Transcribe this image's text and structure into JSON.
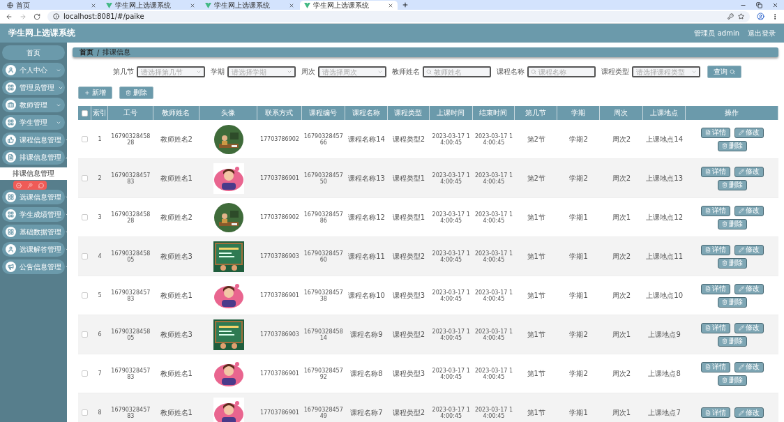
{
  "browser": {
    "tabs": [
      {
        "title": "首页",
        "selected": false,
        "kind": "globe"
      },
      {
        "title": "学生网上选课系统",
        "selected": false,
        "kind": "vue"
      },
      {
        "title": "学生网上选课系统",
        "selected": false,
        "kind": "vue"
      },
      {
        "title": "学生网上选课系统",
        "selected": true,
        "kind": "vue"
      }
    ],
    "address": "localhost:8081/#/paike"
  },
  "header": {
    "title": "学生网上选课系统",
    "user": "管理员 admin",
    "logout": "退出登录"
  },
  "sidebar": {
    "items": [
      {
        "label": "首页",
        "kind": "home"
      },
      {
        "label": "个人中心",
        "kind": "menu",
        "expanded": false
      },
      {
        "label": "管理员管理",
        "kind": "menu",
        "expanded": false
      },
      {
        "label": "教师管理",
        "kind": "menu",
        "expanded": false
      },
      {
        "label": "学生管理",
        "kind": "menu",
        "expanded": false
      },
      {
        "label": "课程信息管理",
        "kind": "menu",
        "expanded": false
      },
      {
        "label": "排课信息管理",
        "kind": "menu",
        "expanded": true,
        "children": [
          {
            "label": "排课信息管理"
          }
        ]
      },
      {
        "label": "选课信息管理",
        "kind": "menu",
        "expanded": false
      },
      {
        "label": "学生成绩管理",
        "kind": "menu",
        "expanded": false
      },
      {
        "label": "基础数据管理",
        "kind": "menu",
        "expanded": false
      },
      {
        "label": "选课解答管理",
        "kind": "menu",
        "expanded": false
      },
      {
        "label": "公告信息管理",
        "kind": "menu",
        "expanded": false
      }
    ]
  },
  "breadcrumb": {
    "items": [
      "首页",
      "排课信息"
    ],
    "separator": "/"
  },
  "filters": [
    {
      "label": "第几节",
      "kind": "select",
      "placeholder": "请选择第几节"
    },
    {
      "label": "学期",
      "kind": "select",
      "placeholder": "请选择学期"
    },
    {
      "label": "周次",
      "kind": "select",
      "placeholder": "请选择周次"
    },
    {
      "label": "教师姓名",
      "kind": "input",
      "placeholder": "教师姓名"
    },
    {
      "label": "课程名称",
      "kind": "input",
      "placeholder": "课程名称"
    },
    {
      "label": "课程类型",
      "kind": "select",
      "placeholder": "请选择课程类型"
    }
  ],
  "search_button": "查询",
  "toolbar": [
    {
      "label": "新增",
      "kind": "add"
    },
    {
      "label": "删除",
      "kind": "delete"
    }
  ],
  "table": {
    "all_checked": false,
    "columns": [
      "索引",
      "工号",
      "教师姓名",
      "头像",
      "联系方式",
      "课程编号",
      "课程名称",
      "课程类型",
      "上课时间",
      "结束时间",
      "第几节",
      "学期",
      "周次",
      "上课地点",
      "操作"
    ],
    "rows": [
      {
        "checked": false,
        "index": "1",
        "id": "1679032845828",
        "teacher": "教师姓名2",
        "phone": "17703786902",
        "course_no": "1679032845766",
        "course_name": "课程名称14",
        "course_type": "课程类型2",
        "start": "2023-03-17 14:00:45",
        "end": "2023-03-17 14:00:45",
        "section": "第2节",
        "term": "学期2",
        "week": "周次2",
        "place": "上课地点14",
        "actions": [
          {
            "label": "详情",
            "kind": "detail"
          },
          {
            "label": "修改",
            "kind": "edit"
          },
          {
            "label": "删除",
            "kind": "delete"
          }
        ]
      },
      {
        "checked": false,
        "index": "2",
        "id": "1679032845783",
        "teacher": "教师姓名1",
        "phone": "17703786901",
        "course_no": "1679032845750",
        "course_name": "课程名称13",
        "course_type": "课程类型1",
        "start": "2023-03-17 14:00:45",
        "end": "2023-03-17 14:00:45",
        "section": "第2节",
        "term": "学期2",
        "week": "周次2",
        "place": "上课地点13",
        "actions": [
          {
            "label": "详情",
            "kind": "detail"
          },
          {
            "label": "修改",
            "kind": "edit"
          },
          {
            "label": "删除",
            "kind": "delete"
          }
        ]
      },
      {
        "checked": false,
        "index": "3",
        "id": "1679032845828",
        "teacher": "教师姓名2",
        "phone": "17703786902",
        "course_no": "1679032845786",
        "course_name": "课程名称12",
        "course_type": "课程类型1",
        "start": "2023-03-17 14:00:45",
        "end": "2023-03-17 14:00:45",
        "section": "第1节",
        "term": "学期1",
        "week": "周次1",
        "place": "上课地点12",
        "actions": [
          {
            "label": "详情",
            "kind": "detail"
          },
          {
            "label": "修改",
            "kind": "edit"
          },
          {
            "label": "删除",
            "kind": "delete"
          }
        ]
      },
      {
        "checked": false,
        "index": "4",
        "id": "1679032845805",
        "teacher": "教师姓名3",
        "phone": "17703786903",
        "course_no": "1679032845760",
        "course_name": "课程名称11",
        "course_type": "课程类型2",
        "start": "2023-03-17 14:00:45",
        "end": "2023-03-17 14:00:45",
        "section": "第1节",
        "term": "学期1",
        "week": "周次2",
        "place": "上课地点11",
        "actions": [
          {
            "label": "详情",
            "kind": "detail"
          },
          {
            "label": "修改",
            "kind": "edit"
          },
          {
            "label": "删除",
            "kind": "delete"
          }
        ]
      },
      {
        "checked": false,
        "index": "5",
        "id": "1679032845783",
        "teacher": "教师姓名1",
        "phone": "17703786901",
        "course_no": "1679032845738",
        "course_name": "课程名称10",
        "course_type": "课程类型3",
        "start": "2023-03-17 14:00:45",
        "end": "2023-03-17 14:00:45",
        "section": "第1节",
        "term": "学期1",
        "week": "周次2",
        "place": "上课地点10",
        "actions": [
          {
            "label": "详情",
            "kind": "detail"
          },
          {
            "label": "修改",
            "kind": "edit"
          },
          {
            "label": "删除",
            "kind": "delete"
          }
        ]
      },
      {
        "checked": false,
        "index": "6",
        "id": "1679032845805",
        "teacher": "教师姓名3",
        "phone": "17703786903",
        "course_no": "1679032845814",
        "course_name": "课程名称9",
        "course_type": "课程类型2",
        "start": "2023-03-17 14:00:45",
        "end": "2023-03-17 14:00:45",
        "section": "第1节",
        "term": "学期2",
        "week": "周次1",
        "place": "上课地点9",
        "actions": [
          {
            "label": "详情",
            "kind": "detail"
          },
          {
            "label": "修改",
            "kind": "edit"
          },
          {
            "label": "删除",
            "kind": "delete"
          }
        ]
      },
      {
        "checked": false,
        "index": "7",
        "id": "1679032845783",
        "teacher": "教师姓名1",
        "phone": "17703786901",
        "course_no": "1679032845792",
        "course_name": "课程名称8",
        "course_type": "课程类型3",
        "start": "2023-03-17 14:00:45",
        "end": "2023-03-17 14:00:45",
        "section": "第1节",
        "term": "学期2",
        "week": "周次2",
        "place": "上课地点8",
        "actions": [
          {
            "label": "详情",
            "kind": "detail"
          },
          {
            "label": "修改",
            "kind": "edit"
          },
          {
            "label": "删除",
            "kind": "delete"
          }
        ]
      },
      {
        "checked": false,
        "index": "8",
        "id": "1679032845783",
        "teacher": "教师姓名1",
        "phone": "17703786901",
        "course_no": "1679032845749",
        "course_name": "课程名称7",
        "course_type": "课程类型2",
        "start": "2023-03-17 14:00:45",
        "end": "2023-03-17 14:00:45",
        "section": "第1节",
        "term": "学期1",
        "week": "周次1",
        "place": "上课地点7",
        "actions": [
          {
            "label": "详情",
            "kind": "detail"
          },
          {
            "label": "修改",
            "kind": "edit"
          }
        ]
      }
    ]
  }
}
